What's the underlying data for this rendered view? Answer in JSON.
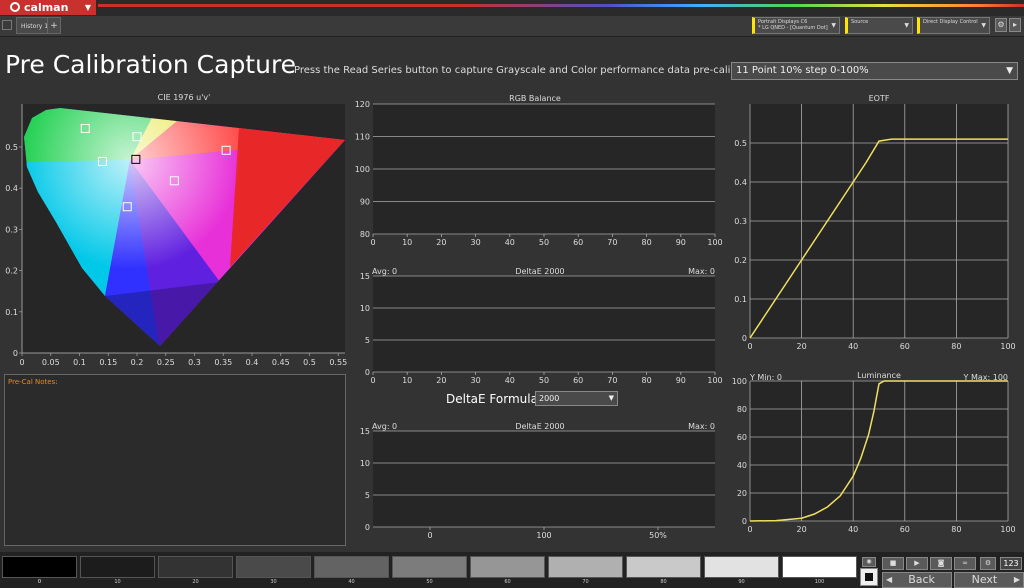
{
  "app": {
    "logo": "calman",
    "tab": "History 1",
    "tab_add": "+"
  },
  "header_controls": {
    "device_line1": "Portrait Displays C6",
    "device_line2": "* LG QNED - [Quantum Dot]",
    "source": "Source",
    "display_control": "Direct Display Control",
    "accent_color": "#ffe600"
  },
  "page": {
    "title": "Pre Calibration Capture",
    "instruction": "Press the Read Series button to capture Grayscale and Color performance data pre-calibration.",
    "series_selected": "11 Point 10% step 0-100%"
  },
  "cie": {
    "title": "CIE 1976 u'v'",
    "x_ticks": [
      "0",
      "0.05",
      "0.1",
      "0.15",
      "0.2",
      "0.25",
      "0.3",
      "0.35",
      "0.4",
      "0.45",
      "0.5",
      "0.55"
    ],
    "y_ticks": [
      "0",
      "0.1",
      "0.2",
      "0.3",
      "0.4",
      "0.5"
    ],
    "targets": [
      {
        "u": 0.11,
        "v": 0.545,
        "sel": false
      },
      {
        "u": 0.2,
        "v": 0.525,
        "sel": false
      },
      {
        "u": 0.14,
        "v": 0.465,
        "sel": false
      },
      {
        "u": 0.198,
        "v": 0.47,
        "sel": true
      },
      {
        "u": 0.355,
        "v": 0.492,
        "sel": false
      },
      {
        "u": 0.265,
        "v": 0.418,
        "sel": false
      },
      {
        "u": 0.183,
        "v": 0.355,
        "sel": false
      }
    ]
  },
  "rgb_balance": {
    "title": "RGB Balance",
    "x_ticks": [
      "0",
      "10",
      "20",
      "30",
      "40",
      "50",
      "60",
      "70",
      "80",
      "90",
      "100"
    ],
    "y_ticks": [
      "80",
      "90",
      "100",
      "110",
      "120"
    ]
  },
  "deltae_gray": {
    "avg": "Avg: 0",
    "max": "Max: 0",
    "title": "DeltaE 2000",
    "x_ticks": [
      "0",
      "10",
      "20",
      "30",
      "40",
      "50",
      "60",
      "70",
      "80",
      "90",
      "100"
    ],
    "y_ticks": [
      "0",
      "5",
      "10",
      "15"
    ]
  },
  "deltae_formula": {
    "label": "DeltaE Formula",
    "value": "2000"
  },
  "deltae_sat": {
    "avg": "Avg: 0",
    "max": "Max: 0",
    "title": "DeltaE 2000",
    "x_ticks": [
      "0",
      "100",
      "50%"
    ],
    "y_ticks": [
      "0",
      "5",
      "10",
      "15"
    ]
  },
  "notes": {
    "label": "Pre-Cal Notes:"
  },
  "chart_data": [
    {
      "type": "line",
      "title": "EOTF",
      "x": [
        0,
        5,
        10,
        15,
        20,
        25,
        30,
        35,
        40,
        45,
        50,
        55,
        60,
        70,
        80,
        90,
        100
      ],
      "series": [
        {
          "values": [
            0,
            0.05,
            0.1,
            0.15,
            0.2,
            0.25,
            0.3,
            0.35,
            0.4,
            0.45,
            0.505,
            0.51,
            0.51,
            0.51,
            0.51,
            0.51,
            0.51
          ]
        }
      ],
      "x_ticks": [
        "0",
        "20",
        "40",
        "60",
        "80",
        "100"
      ],
      "y_ticks": [
        "0",
        "0.1",
        "0.2",
        "0.3",
        "0.4",
        "0.5"
      ],
      "xlim": [
        0,
        100
      ],
      "ylim": [
        0,
        0.6
      ],
      "line_color": "#f0e060"
    },
    {
      "type": "line",
      "title": "Luminance",
      "y_min_label": "Y Min: 0",
      "y_max_label": "Y Max: 100",
      "x": [
        0,
        10,
        20,
        25,
        30,
        35,
        40,
        43,
        46,
        48,
        50,
        52,
        60,
        70,
        80,
        90,
        100
      ],
      "series": [
        {
          "values": [
            0,
            0.3,
            2,
            5,
            10,
            18,
            32,
            45,
            62,
            78,
            98,
            100,
            100,
            100,
            100,
            100,
            100
          ]
        }
      ],
      "x_ticks": [
        "0",
        "20",
        "40",
        "60",
        "80",
        "100"
      ],
      "y_ticks": [
        "0",
        "20",
        "40",
        "60",
        "80",
        "100"
      ],
      "xlim": [
        0,
        100
      ],
      "ylim": [
        0,
        100
      ],
      "line_color": "#f0e060"
    }
  ],
  "swatches": [
    {
      "label": "0",
      "color": "#000000"
    },
    {
      "label": "10",
      "color": "#1c1c1c"
    },
    {
      "label": "20",
      "color": "#333333"
    },
    {
      "label": "30",
      "color": "#4a4a4a"
    },
    {
      "label": "40",
      "color": "#636363"
    },
    {
      "label": "50",
      "color": "#7c7c7c"
    },
    {
      "label": "60",
      "color": "#969696"
    },
    {
      "label": "70",
      "color": "#b0b0b0"
    },
    {
      "label": "80",
      "color": "#c9c9c9"
    },
    {
      "label": "90",
      "color": "#e2e2e2"
    },
    {
      "label": "100",
      "color": "#ffffff"
    }
  ],
  "nav": {
    "back": "Back",
    "next": "Next",
    "num": "123"
  }
}
